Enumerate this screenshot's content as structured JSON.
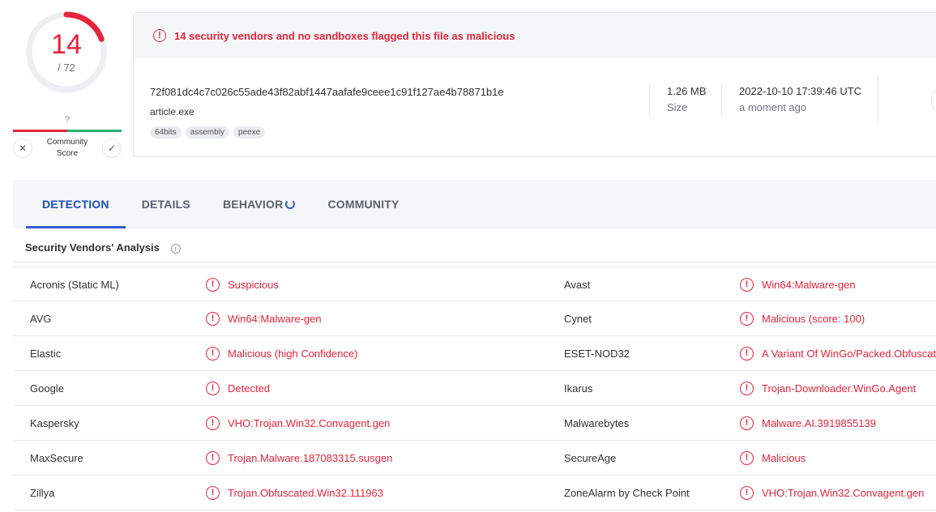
{
  "score": {
    "detections": "14",
    "total": "/ 72",
    "fraction": 0.194
  },
  "community": {
    "value": "?",
    "label_line1": "Community",
    "label_line2": "Score",
    "down_icon": "x-icon",
    "up_icon": "check-icon"
  },
  "summary": {
    "alert": "14 security vendors and no sandboxes flagged this file as malicious",
    "hash": "72f081dc4c7c026c55ade43f82abf1447aafafe9ceee1c91f127ae4b78871b1e",
    "filename": "article.exe",
    "tags": [
      "64bits",
      "assembly",
      "peexe"
    ],
    "size_value": "1.26 MB",
    "size_label": "Size",
    "date_value": "2022-10-10 17:39:46 UTC",
    "date_label": "a moment ago"
  },
  "tabs": [
    "DETECTION",
    "DETAILS",
    "BEHAVIOR",
    "COMMUNITY"
  ],
  "section_title": "Security Vendors' Analysis",
  "vendors": [
    {
      "left_name": "Acronis (Static ML)",
      "left_result": "Suspicious",
      "right_name": "Avast",
      "right_result": "Win64:Malware-gen"
    },
    {
      "left_name": "AVG",
      "left_result": "Win64:Malware-gen",
      "right_name": "Cynet",
      "right_result": "Malicious (score: 100)"
    },
    {
      "left_name": "Elastic",
      "left_result": "Malicious (high Confidence)",
      "right_name": "ESET-NOD32",
      "right_result": "A Variant Of WinGo/Packed.Obfuscat"
    },
    {
      "left_name": "Google",
      "left_result": "Detected",
      "right_name": "Ikarus",
      "right_result": "Trojan-Downloader.WinGo.Agent"
    },
    {
      "left_name": "Kaspersky",
      "left_result": "VHO:Trojan.Win32.Convagent.gen",
      "right_name": "Malwarebytes",
      "right_result": "Malware.AI.3919855139"
    },
    {
      "left_name": "MaxSecure",
      "left_result": "Trojan.Malware.187083315.susgen",
      "right_name": "SecureAge",
      "right_result": "Malicious"
    },
    {
      "left_name": "Zillya",
      "left_result": "Trojan.Obfuscated.Win32.111963",
      "right_name": "ZoneAlarm by Check Point",
      "right_result": "VHO:Trojan.Win32.Convagent.gen"
    }
  ]
}
